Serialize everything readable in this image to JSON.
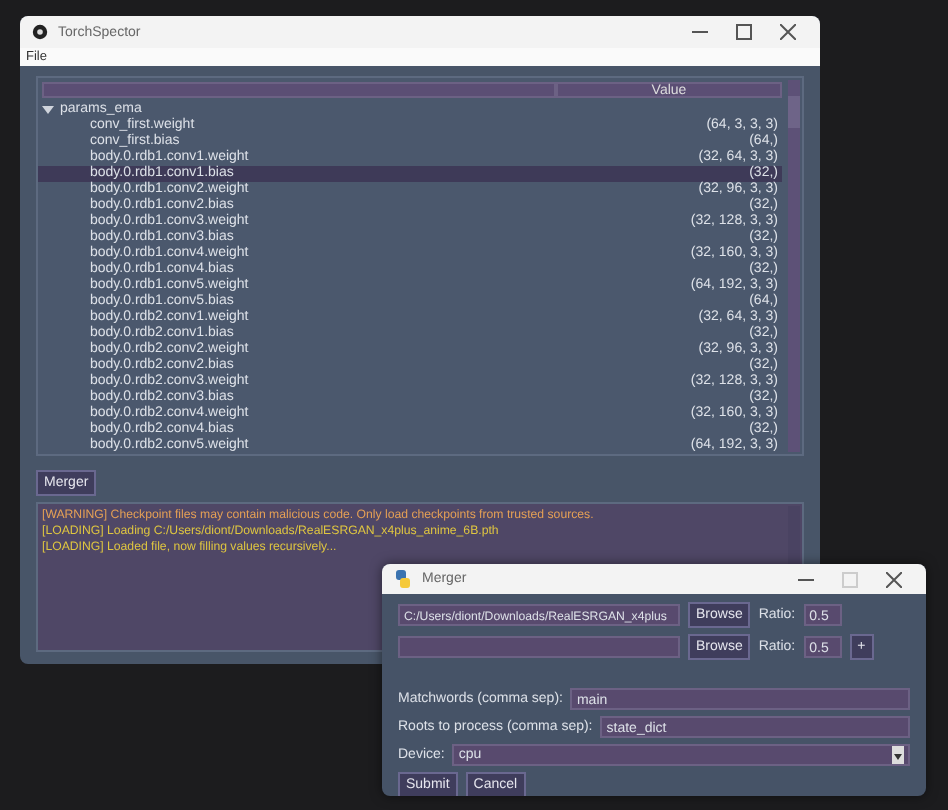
{
  "main_window": {
    "title": "TorchSpector",
    "menu": [
      "File"
    ],
    "tree": {
      "columns": [
        "Value"
      ],
      "nodes": [
        {
          "name": "params_ema",
          "expanded": true,
          "selected": false,
          "children": [
            {
              "name": "conv_first.weight",
              "value": "(64, 3, 3, 3)",
              "selected": false
            },
            {
              "name": "conv_first.bias",
              "value": "(64,)",
              "selected": false
            },
            {
              "name": "body.0.rdb1.conv1.weight",
              "value": "(32, 64, 3, 3)",
              "selected": false
            },
            {
              "name": "body.0.rdb1.conv1.bias",
              "value": "(32,)",
              "selected": true
            },
            {
              "name": "body.0.rdb1.conv2.weight",
              "value": "(32, 96, 3, 3)",
              "selected": false
            },
            {
              "name": "body.0.rdb1.conv2.bias",
              "value": "(32,)",
              "selected": false
            },
            {
              "name": "body.0.rdb1.conv3.weight",
              "value": "(32, 128, 3, 3)",
              "selected": false
            },
            {
              "name": "body.0.rdb1.conv3.bias",
              "value": "(32,)",
              "selected": false
            },
            {
              "name": "body.0.rdb1.conv4.weight",
              "value": "(32, 160, 3, 3)",
              "selected": false
            },
            {
              "name": "body.0.rdb1.conv4.bias",
              "value": "(32,)",
              "selected": false
            },
            {
              "name": "body.0.rdb1.conv5.weight",
              "value": "(64, 192, 3, 3)",
              "selected": false
            },
            {
              "name": "body.0.rdb1.conv5.bias",
              "value": "(64,)",
              "selected": false
            },
            {
              "name": "body.0.rdb2.conv1.weight",
              "value": "(32, 64, 3, 3)",
              "selected": false
            },
            {
              "name": "body.0.rdb2.conv1.bias",
              "value": "(32,)",
              "selected": false
            },
            {
              "name": "body.0.rdb2.conv2.weight",
              "value": "(32, 96, 3, 3)",
              "selected": false
            },
            {
              "name": "body.0.rdb2.conv2.bias",
              "value": "(32,)",
              "selected": false
            },
            {
              "name": "body.0.rdb2.conv3.weight",
              "value": "(32, 128, 3, 3)",
              "selected": false
            },
            {
              "name": "body.0.rdb2.conv3.bias",
              "value": "(32,)",
              "selected": false
            },
            {
              "name": "body.0.rdb2.conv4.weight",
              "value": "(32, 160, 3, 3)",
              "selected": false
            },
            {
              "name": "body.0.rdb2.conv4.bias",
              "value": "(32,)",
              "selected": false
            },
            {
              "name": "body.0.rdb2.conv5.weight",
              "value": "(64, 192, 3, 3)",
              "selected": false
            }
          ]
        }
      ]
    },
    "merger_button": "Merger",
    "log": [
      {
        "kind": "warning",
        "text": "[WARNING] Checkpoint files may contain malicious code. Only load checkpoints from trusted sources."
      },
      {
        "kind": "loading",
        "text": "[LOADING] Loading C:/Users/diont/Downloads/RealESRGAN_x4plus_anime_6B.pth"
      },
      {
        "kind": "loading",
        "text": "[LOADING] Loaded file, now filling values recursively..."
      }
    ]
  },
  "merger_window": {
    "title": "Merger",
    "models": [
      {
        "path": "C:/Users/diont/Downloads/RealESRGAN_x4plus",
        "browse": "Browse",
        "ratio_label": "Ratio:",
        "ratio": "0.5"
      },
      {
        "browse": "Browse",
        "ratio_label": "Ratio:",
        "ratio": "0.5",
        "add": "+"
      }
    ],
    "fields": [
      {
        "label": "Matchwords (comma sep):",
        "value": "main"
      },
      {
        "label": "Roots to process (comma sep):",
        "value": "state_dict"
      }
    ],
    "device": {
      "label": "Device:",
      "value": "cpu"
    },
    "buttons": [
      "Submit",
      "Cancel"
    ]
  }
}
